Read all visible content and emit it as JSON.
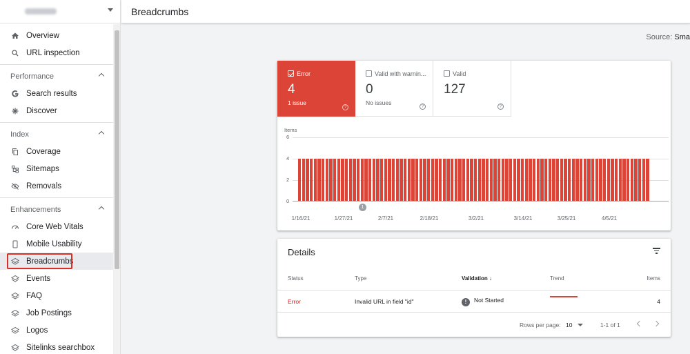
{
  "sidebar": {
    "overview": "Overview",
    "url_inspection": "URL inspection",
    "sections": {
      "performance": "Performance",
      "index": "Index",
      "enhancements": "Enhancements"
    },
    "performance_items": [
      "Search results",
      "Discover"
    ],
    "index_items": [
      "Coverage",
      "Sitemaps",
      "Removals"
    ],
    "enhancement_items": [
      "Core Web Vitals",
      "Mobile Usability",
      "Breadcrumbs",
      "Events",
      "FAQ",
      "Job Postings",
      "Logos",
      "Sitelinks searchbox"
    ],
    "active_item": "Breadcrumbs"
  },
  "header": {
    "title": "Breadcrumbs"
  },
  "source": {
    "label": "Source:",
    "value": "Sma"
  },
  "summary": {
    "error": {
      "label": "Error",
      "count": "4",
      "sub": "1 issue",
      "checked": true,
      "color": "#dc4437"
    },
    "warning": {
      "label": "Valid with warnin...",
      "count": "0",
      "sub": "No issues",
      "checked": false
    },
    "valid": {
      "label": "Valid",
      "count": "127",
      "sub": "",
      "checked": false
    }
  },
  "chart_data": {
    "type": "bar",
    "ylabel": "Items",
    "ylim": [
      0,
      6
    ],
    "yticks": [
      "6",
      "4",
      "2",
      "0"
    ],
    "xticks": [
      "1/16/21",
      "1/27/21",
      "2/7/21",
      "2/18/21",
      "3/2/21",
      "3/14/21",
      "3/25/21",
      "4/5/21"
    ],
    "series": [
      {
        "values": [
          4,
          4,
          4,
          4,
          4,
          4,
          4,
          4,
          4,
          4,
          4,
          4,
          4,
          4,
          4,
          4,
          4,
          4,
          4,
          4,
          4,
          4,
          4,
          4,
          4,
          4,
          4,
          4,
          4,
          4,
          4,
          4,
          4,
          4,
          4,
          4,
          4,
          4,
          4,
          4,
          4,
          4,
          4,
          4,
          4,
          4,
          4,
          4,
          4,
          4,
          4,
          4,
          4,
          4,
          4,
          4,
          4,
          4,
          4,
          4,
          4,
          4,
          4,
          4,
          4,
          4,
          4,
          4,
          4,
          4,
          4,
          4,
          4,
          4,
          4,
          4,
          4,
          4,
          4,
          4,
          4,
          4,
          4,
          4,
          4,
          4,
          4,
          4,
          4,
          4
        ]
      }
    ],
    "annotation": "1",
    "color": "#dc4437"
  },
  "details": {
    "title": "Details",
    "columns": {
      "status": "Status",
      "type": "Type",
      "validation": "Validation",
      "trend": "Trend",
      "items": "Items"
    },
    "rows": [
      {
        "status": "Error",
        "type": "Invalid URL in field \"id\"",
        "validation": "Not Started",
        "items": "4"
      }
    ],
    "footer": {
      "rows_per_page_label": "Rows per page:",
      "rows_per_page": "10",
      "range": "1-1 of 1"
    }
  }
}
